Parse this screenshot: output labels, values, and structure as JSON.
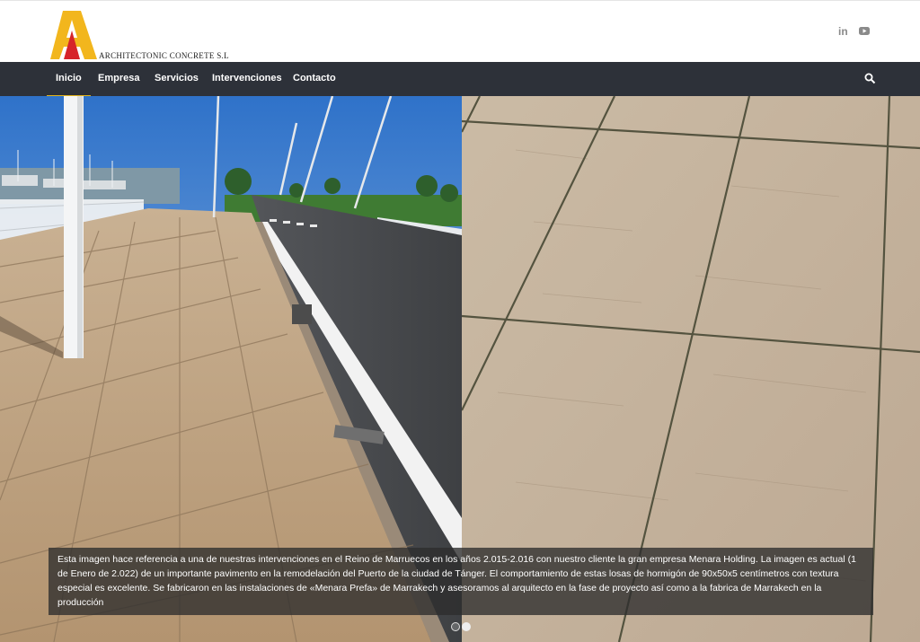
{
  "header": {
    "company_name": "ARCHITECTONIC CONCRETE S.L",
    "logo_letter": "A",
    "social": [
      {
        "name": "linkedin",
        "label": "in"
      },
      {
        "name": "youtube",
        "icon": "youtube-icon"
      }
    ]
  },
  "nav": {
    "items": [
      {
        "label": "Inicio",
        "active": true
      },
      {
        "label": "Empresa",
        "active": false
      },
      {
        "label": "Servicios",
        "active": false
      },
      {
        "label": "Intervenciones",
        "active": false
      },
      {
        "label": "Contacto",
        "active": false
      }
    ],
    "search_icon": "search-icon"
  },
  "slider": {
    "caption": "Esta imagen hace referencia a una de nuestras intervenciones en el Reino de Marruecos en los años 2.015-2.016 con nuestro cliente la gran empresa Menara Holding. La imagen es actual (1 de Enero de 2.022) de un importante pavimento en la remodelación del Puerto de la ciudad de Tánger. El comportamiento de estas losas de hormigón de 90x50x5 centímetros con textura especial es excelente. Se fabricaron en las instalaciones de «Menara Prefa» de Marrakech y asesoramos al arquitecto en la fase de proyecto así como a la fabrica de Marrakech en la producción",
    "slide_count": 2,
    "active_slide": 2
  },
  "colors": {
    "nav_bg": "#2d3139",
    "accent": "#e4b41a",
    "logo_yellow": "#f2b61d",
    "logo_red": "#d6232a"
  }
}
